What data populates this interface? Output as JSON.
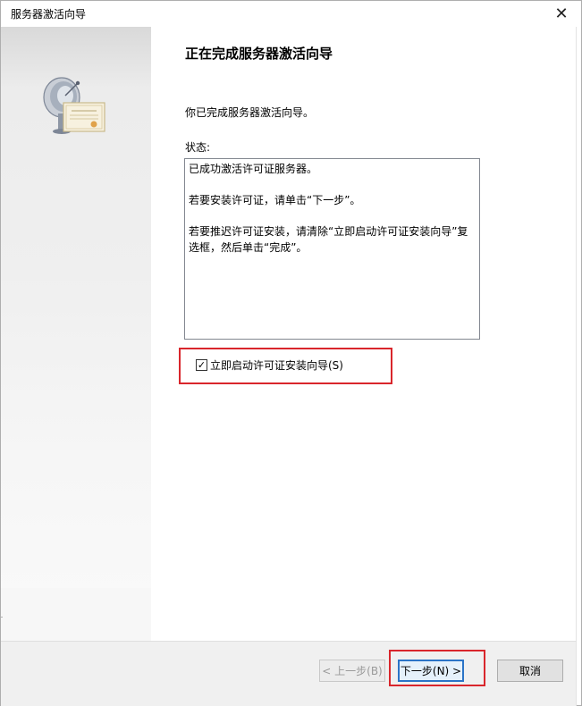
{
  "window": {
    "title": "服务器激活向导",
    "close_glyph": "✕"
  },
  "sidebar": {
    "icon": "satellite-dish-certificate-icon"
  },
  "content": {
    "heading": "正在完成服务器激活向导",
    "description": "你已完成服务器激活向导。",
    "status_label": "状态:",
    "status_lines": [
      "已成功激活许可证服务器。",
      "若要安装许可证，请单击“下一步”。",
      "若要推迟许可证安装，请清除“立即启动许可证安装向导”复选框，然后单击“完成”。"
    ],
    "checkbox": {
      "label": "立即启动许可证安装向导(S)",
      "checked": true,
      "check_glyph": "✓"
    }
  },
  "footer": {
    "back_label": "< 上一步(B)",
    "next_label": "下一步(N) >",
    "cancel_label": "取消"
  },
  "colors": {
    "highlight": "#d9262c",
    "focus_border": "#2b74c7"
  }
}
